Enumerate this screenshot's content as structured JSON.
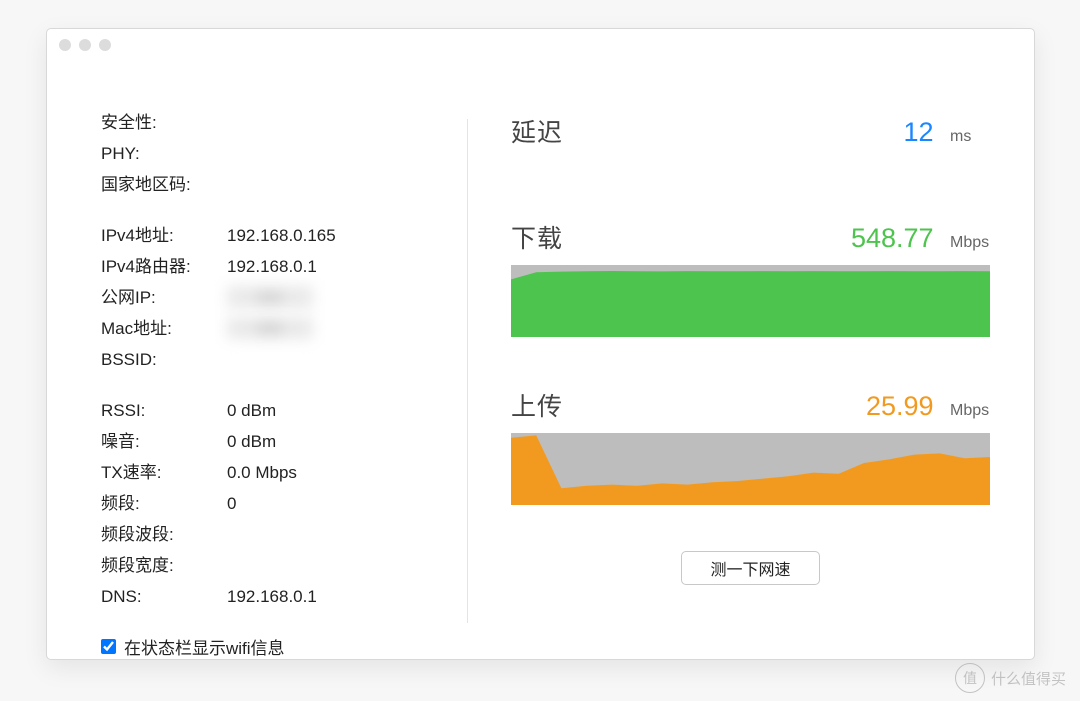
{
  "info": {
    "group1": {
      "security_label": "安全性:",
      "security_value": "",
      "phy_label": "PHY:",
      "phy_value": "",
      "country_label": "国家地区码:",
      "country_value": ""
    },
    "group2": {
      "ipv4_addr_label": "IPv4地址:",
      "ipv4_addr_value": "192.168.0.165",
      "ipv4_router_label": "IPv4路由器:",
      "ipv4_router_value": "192.168.0.1",
      "public_ip_label": "公网IP:",
      "public_ip_value": "xxx",
      "mac_label": "Mac地址:",
      "mac_value": "xxx",
      "bssid_label": "BSSID:",
      "bssid_value": ""
    },
    "group3": {
      "rssi_label": "RSSI:",
      "rssi_value": "0 dBm",
      "noise_label": "噪音:",
      "noise_value": "0 dBm",
      "tx_label": "TX速率:",
      "tx_value": "0.0 Mbps",
      "channel_label": "频段:",
      "channel_value": "0",
      "band_label": "频段波段:",
      "band_value": "",
      "width_label": "频段宽度:",
      "width_value": "",
      "dns_label": "DNS:",
      "dns_value": "192.168.0.1"
    },
    "checkbox_label": "在状态栏显示wifi信息"
  },
  "metrics": {
    "latency_title": "延迟",
    "latency_value": "12",
    "latency_unit": "ms",
    "download_title": "下载",
    "download_value": "548.77",
    "download_unit": "Mbps",
    "upload_title": "上传",
    "upload_value": "25.99",
    "upload_unit": "Mbps",
    "test_button": "测一下网速"
  },
  "watermark": {
    "badge": "值",
    "text": "什么值得买"
  },
  "colors": {
    "latency": "#1b87ff",
    "download": "#4cc44d",
    "upload": "#f29a1f",
    "chart_bg": "#bdbdbd"
  },
  "chart_data": [
    {
      "type": "area",
      "title": "下载",
      "ylabel": "Mbps",
      "ylim": [
        0,
        600
      ],
      "x": [
        0,
        1,
        2,
        3,
        4,
        5,
        6,
        7,
        8,
        9,
        10,
        11,
        12,
        13,
        14,
        15,
        16,
        17,
        18,
        19
      ],
      "values": [
        480,
        540,
        545,
        548,
        550,
        548,
        547,
        549,
        548,
        548,
        549,
        548,
        549,
        548,
        548,
        549,
        548,
        548,
        549,
        548
      ],
      "color": "#4cc44d"
    },
    {
      "type": "area",
      "title": "上传",
      "ylabel": "Mbps",
      "ylim": [
        0,
        60
      ],
      "x": [
        0,
        1,
        2,
        3,
        4,
        5,
        6,
        7,
        8,
        9,
        10,
        11,
        12,
        13,
        14,
        15,
        16,
        17,
        18,
        19
      ],
      "values": [
        56,
        58,
        14,
        16,
        17,
        16,
        18,
        17,
        19,
        20,
        22,
        24,
        27,
        26,
        35,
        38,
        42,
        43,
        39,
        40
      ],
      "color": "#f29a1f"
    }
  ]
}
